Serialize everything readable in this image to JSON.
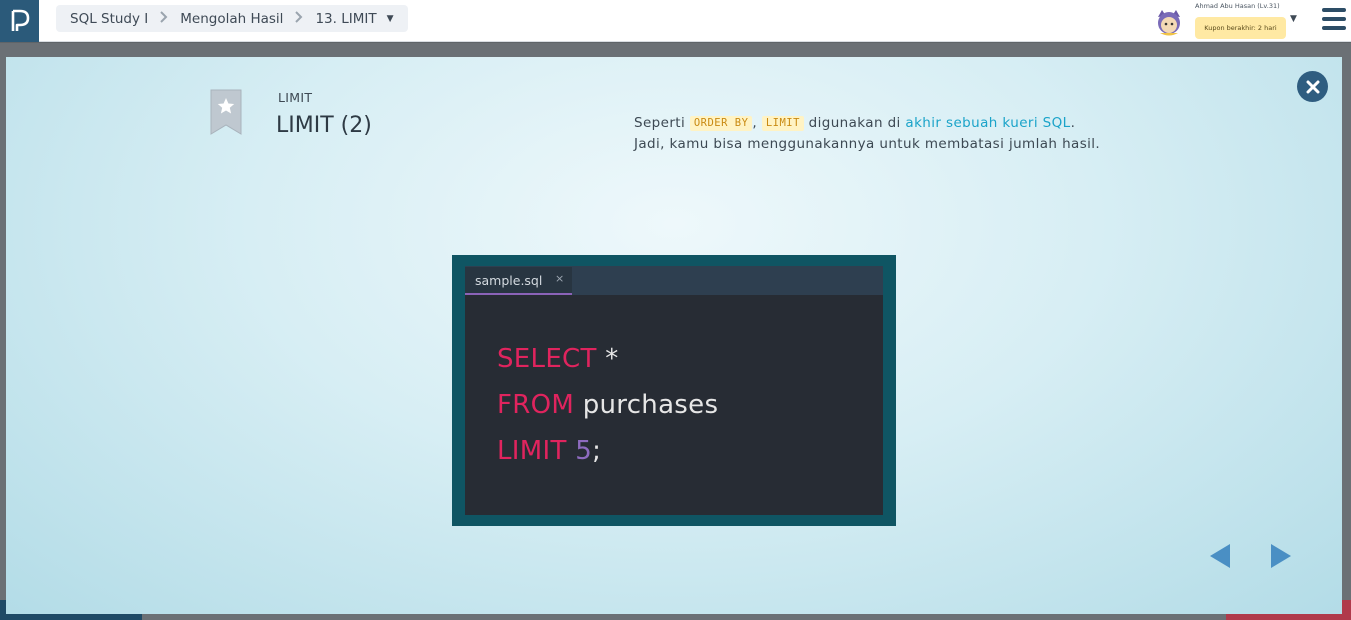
{
  "breadcrumb": {
    "course": "SQL Study I",
    "chapter": "Mengolah Hasil",
    "lesson": "13. LIMIT"
  },
  "user": {
    "name": "Ahmad Abu Hasan (Lv.31)",
    "coupon": "Kupon berakhir: 2 hari"
  },
  "slide": {
    "category": "LIMIT",
    "title": "LIMIT (2)",
    "desc_part1": "Seperti ",
    "chip1": "ORDER BY",
    "desc_part2": ", ",
    "chip2": "LIMIT",
    "desc_part3": " digunakan di ",
    "link": "akhir sebuah kueri SQL",
    "desc_part4": ".",
    "desc_line2": "Jadi, kamu bisa menggunakannya untuk membatasi jumlah hasil."
  },
  "editor": {
    "tab_label": "sample.sql",
    "tab_close": "×",
    "kw1": "SELECT",
    "rest1": " *",
    "kw2": "FROM",
    "rest2": " purchases",
    "kw3": "LIMIT",
    "num3": " 5",
    "rest3": ";"
  },
  "colors": {
    "keyword": "#e0245e",
    "number": "#8e6bbf",
    "accent": "#1aa3c9",
    "nav_blue": "#2f5d80"
  },
  "icons": [
    "logo-icon",
    "chevron-right-icon",
    "caret-down-icon",
    "avatar-icon",
    "hamburger-menu-icon",
    "bookmark-star-icon",
    "close-icon",
    "arrow-left-icon",
    "arrow-right-icon"
  ]
}
